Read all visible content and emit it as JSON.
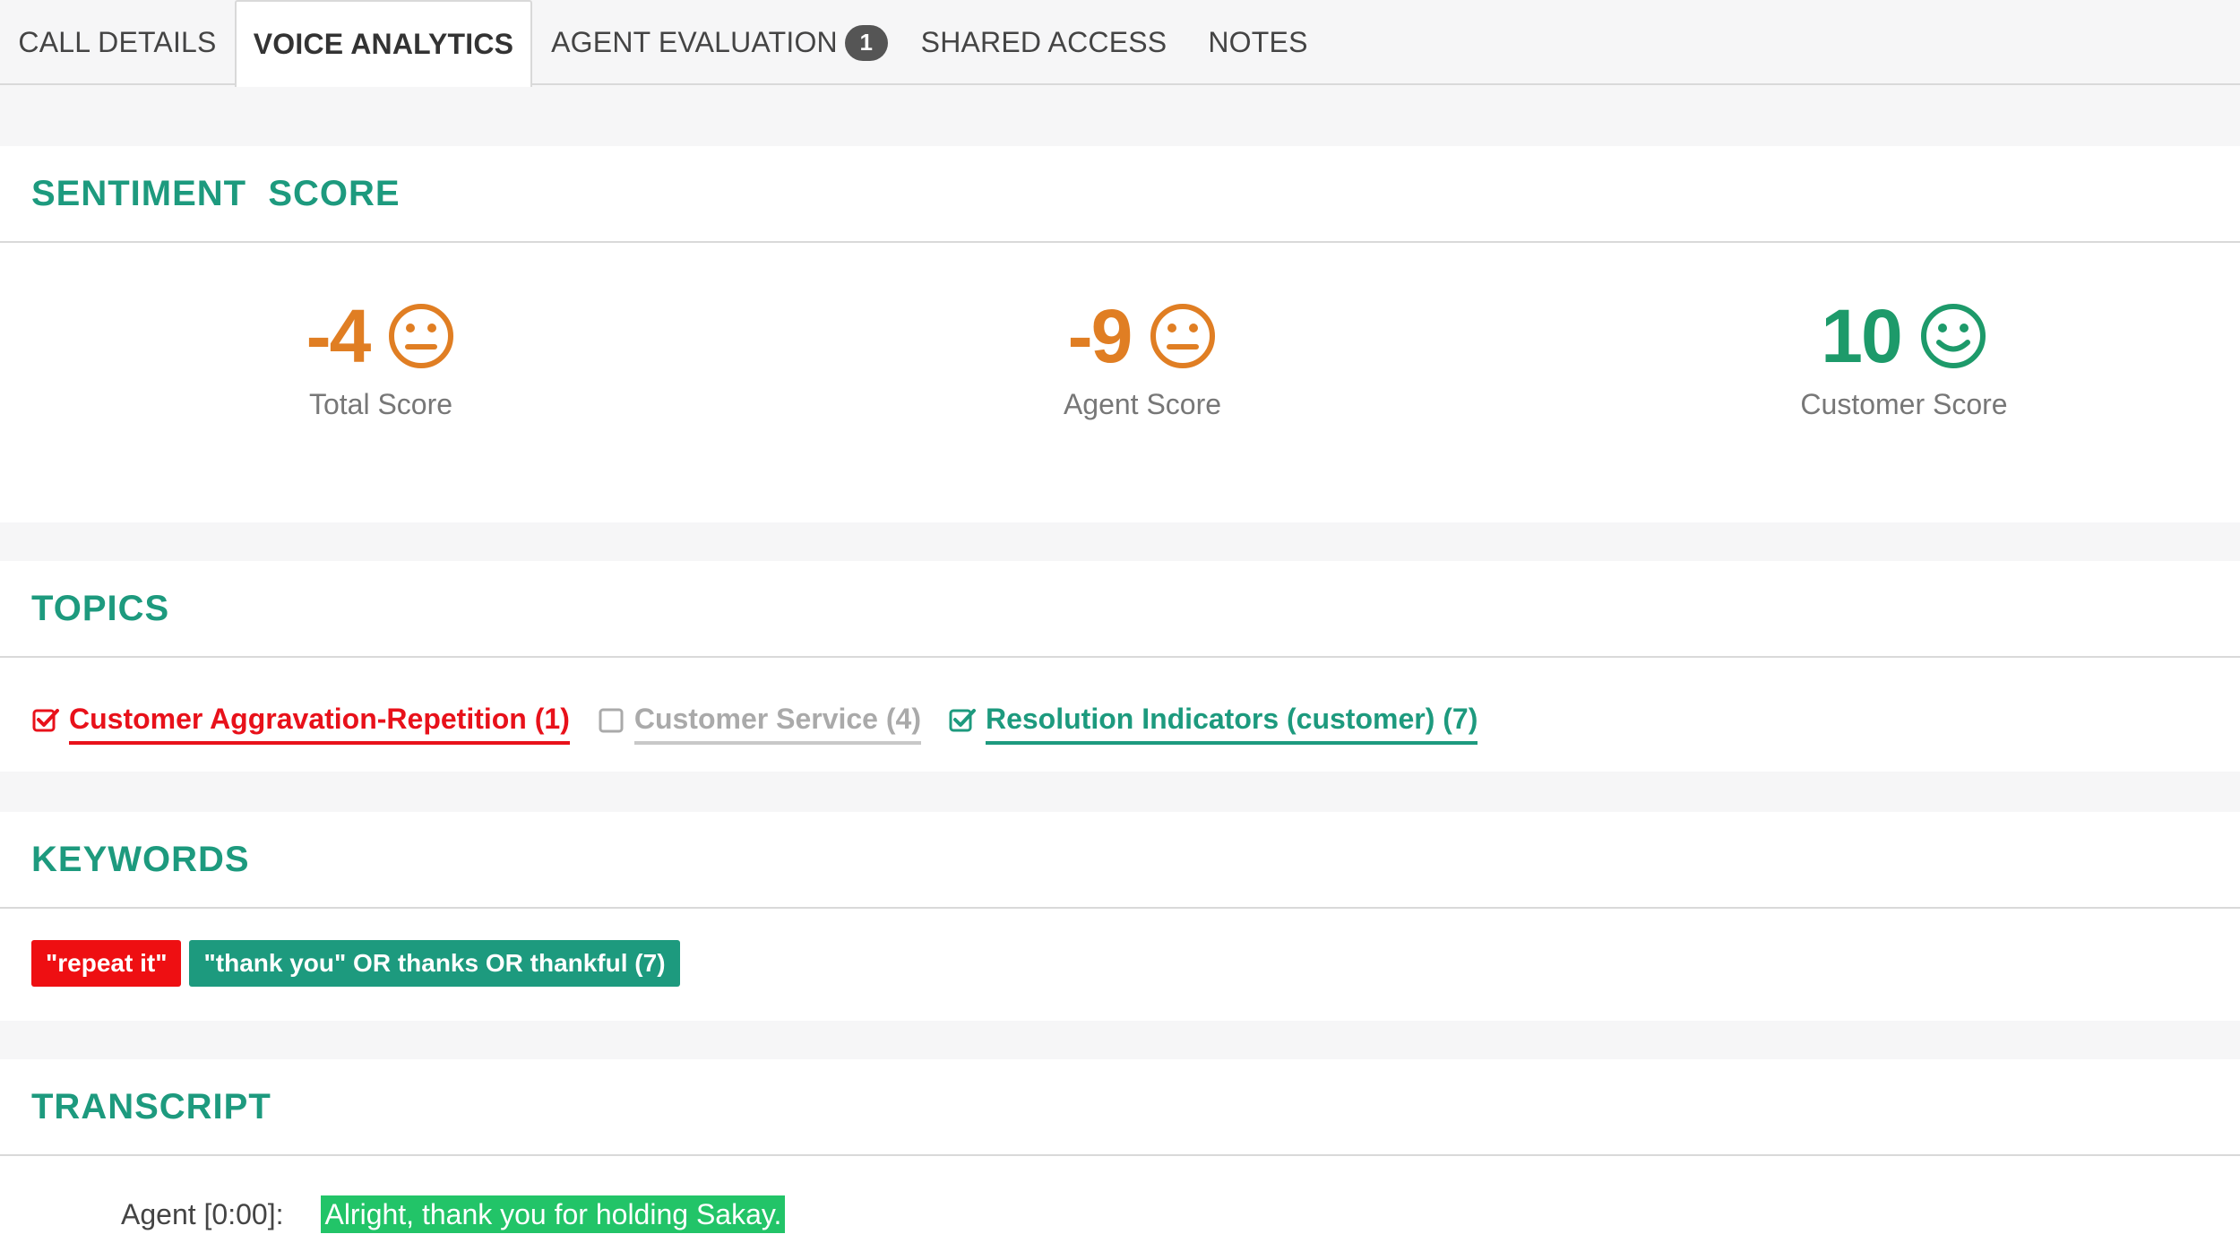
{
  "tabs": [
    {
      "label": "CALL DETAILS",
      "active": false
    },
    {
      "label": "VOICE ANALYTICS",
      "active": true
    },
    {
      "label": "AGENT EVALUATION",
      "active": false,
      "badge": "1"
    },
    {
      "label": "SHARED ACCESS",
      "active": false
    },
    {
      "label": "NOTES",
      "active": false
    }
  ],
  "sentiment": {
    "title": "SENTIMENT  SCORE",
    "scores": [
      {
        "value": "-4",
        "label": "Total Score",
        "face": "neutral-face-icon",
        "color": "#e07e23"
      },
      {
        "value": "-9",
        "label": "Agent Score",
        "face": "neutral-face-icon",
        "color": "#e07e23"
      },
      {
        "value": "10",
        "label": "Customer Score",
        "face": "smile-face-icon",
        "color": "#1d9a6a"
      }
    ]
  },
  "topics": {
    "title": "TOPICS",
    "items": [
      {
        "label": "Customer Aggravation-Repetition (1)",
        "checked": true,
        "color": "#e8111a"
      },
      {
        "label": "Customer Service (4)",
        "checked": false,
        "color": "#aaaaaa"
      },
      {
        "label": "Resolution Indicators (customer) (7)",
        "checked": true,
        "color": "#1d9a7e"
      }
    ]
  },
  "keywords": {
    "title": "KEYWORDS",
    "items": [
      {
        "label": "\"repeat it\"",
        "color": "#ee0f12"
      },
      {
        "label": "\"thank you\" OR thanks OR thankful (7)",
        "color": "#1d9a7e"
      }
    ]
  },
  "transcript": {
    "title": "TRANSCRIPT",
    "lines": [
      {
        "speaker": "Agent [0:00]:",
        "text": "Alright, thank you for holding Sakay."
      }
    ]
  },
  "colors": {
    "accent": "#1d9a7e",
    "negative": "#e8111a",
    "neutral_score": "#e07e23",
    "positive_score": "#1d9a6a",
    "highlight": "#22c468"
  }
}
